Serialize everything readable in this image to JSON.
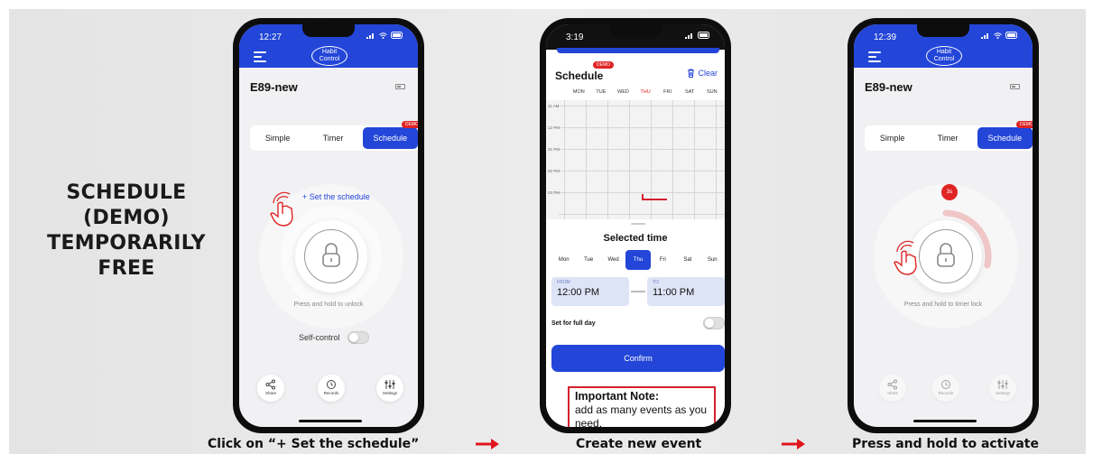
{
  "headline": [
    "SCHEDULE",
    "(DEMO)",
    "TEMPORARILY",
    "FREE"
  ],
  "captions": {
    "step1": "Click on  “+ Set the schedule”",
    "step2": "Create new event",
    "step3": "Press and hold to activate"
  },
  "colors": {
    "accent": "#2346d8",
    "demo": "#e02424",
    "note_border": "#d61f2c"
  },
  "phone1": {
    "time": "12:27",
    "logo": [
      "Habit",
      "Control"
    ],
    "device": "E89-new",
    "tabs": [
      "Simple",
      "Timer",
      "Schedule"
    ],
    "demo_badge": "DEMO",
    "set_link": "+ Set the schedule",
    "hint": "Press and hold to unlock",
    "self_control": "Self-control",
    "nav": [
      "Share",
      "Records",
      "Settings"
    ]
  },
  "phone2": {
    "time": "3:19",
    "title": "Schedule",
    "demo_badge": "DEMO",
    "clear": "Clear",
    "days": [
      "MON",
      "TUE",
      "WED",
      "THU",
      "FRI",
      "SAT",
      "SUN"
    ],
    "hours": [
      "11 AM",
      "12 PM",
      "01 PM",
      "02 PM",
      "03 PM"
    ],
    "sheet_title": "Selected time",
    "week": [
      "Mon",
      "Tue",
      "Wed",
      "Thu",
      "Fri",
      "Sat",
      "Sun"
    ],
    "from_label": "FROM",
    "from_value": "12:00 PM",
    "to_label": "TO",
    "to_value": "11:00 PM",
    "full_day": "Set for full day",
    "confirm": "Confirm",
    "note_title": "Important Note:",
    "note_text": "add as many events as you need."
  },
  "phone3": {
    "time": "12:39",
    "logo": [
      "Habit",
      "Control"
    ],
    "device": "E89-new",
    "tabs": [
      "Simple",
      "Timer",
      "Schedule"
    ],
    "demo_badge": "DEMO",
    "timer": "3s",
    "hint": "Press and hold to timer lock",
    "nav": [
      "Share",
      "Records",
      "Settings"
    ]
  }
}
